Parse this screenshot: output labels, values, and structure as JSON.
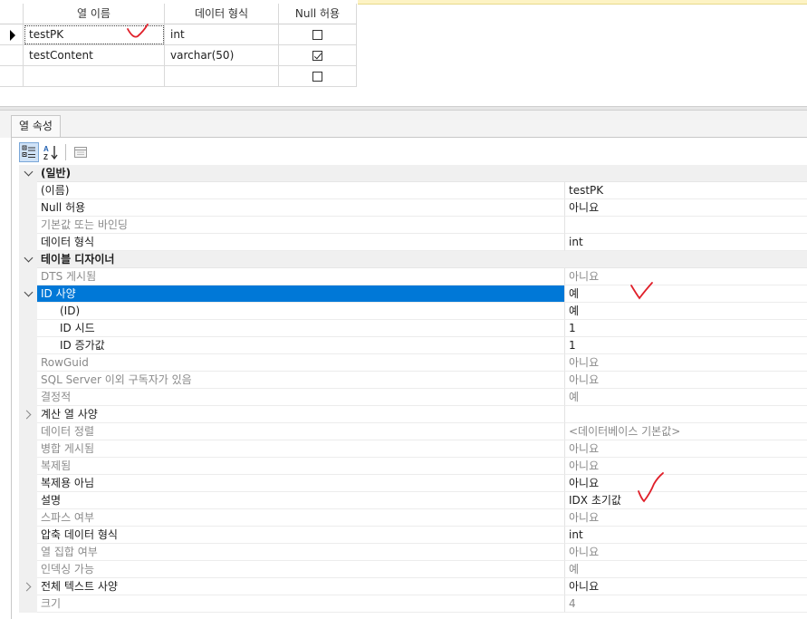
{
  "column_grid": {
    "headers": {
      "name": "열 이름",
      "type": "데이터 형식",
      "nullable": "Null 허용"
    },
    "rows": [
      {
        "name": "testPK",
        "type": "int",
        "nullable": false,
        "current": true
      },
      {
        "name": "testContent",
        "type": "varchar(50)",
        "nullable": true,
        "current": false
      },
      {
        "name": "",
        "type": "",
        "nullable": false,
        "current": false
      }
    ]
  },
  "properties_panel": {
    "tab_label": "열 속성",
    "toolbar": {
      "categorized_icon": "categorized-list-icon",
      "alphabetical_icon": "sort-az-icon",
      "property_pages_icon": "property-pages-icon"
    },
    "rows": [
      {
        "kind": "category",
        "name": "(일반)",
        "value": "",
        "expander": "expanded"
      },
      {
        "kind": "prop",
        "indent": 0,
        "name": "(이름)",
        "value": "testPK",
        "readonly": false
      },
      {
        "kind": "prop",
        "indent": 0,
        "name": "Null 허용",
        "value": "아니요",
        "readonly": false
      },
      {
        "kind": "prop",
        "indent": 0,
        "name": "기본값 또는 바인딩",
        "value": "",
        "readonly": true
      },
      {
        "kind": "prop",
        "indent": 0,
        "name": "데이터 형식",
        "value": "int",
        "readonly": false
      },
      {
        "kind": "category",
        "name": "테이블 디자이너",
        "value": "",
        "expander": "expanded"
      },
      {
        "kind": "prop",
        "indent": 0,
        "name": "DTS 게시됨",
        "value": "아니요",
        "readonly": true
      },
      {
        "kind": "prop",
        "indent": 0,
        "name": "ID 사양",
        "value": "예",
        "readonly": false,
        "selected": true,
        "expander": "expanded"
      },
      {
        "kind": "prop",
        "indent": 1,
        "name": "(ID)",
        "value": "예",
        "readonly": false
      },
      {
        "kind": "prop",
        "indent": 1,
        "name": "ID 시드",
        "value": "1",
        "readonly": false
      },
      {
        "kind": "prop",
        "indent": 1,
        "name": "ID 증가값",
        "value": "1",
        "readonly": false
      },
      {
        "kind": "prop",
        "indent": 0,
        "name": "RowGuid",
        "value": "아니요",
        "readonly": true
      },
      {
        "kind": "prop",
        "indent": 0,
        "name": "SQL Server 이외 구독자가 있음",
        "value": "아니요",
        "readonly": true
      },
      {
        "kind": "prop",
        "indent": 0,
        "name": "결정적",
        "value": "예",
        "readonly": true
      },
      {
        "kind": "prop",
        "indent": 0,
        "name": "계산 열 사양",
        "value": "",
        "readonly": false,
        "expander": "collapsed"
      },
      {
        "kind": "prop",
        "indent": 0,
        "name": "데이터 정렬",
        "value": "<데이터베이스 기본값>",
        "readonly": true
      },
      {
        "kind": "prop",
        "indent": 0,
        "name": "병합 게시됨",
        "value": "아니요",
        "readonly": true
      },
      {
        "kind": "prop",
        "indent": 0,
        "name": "복제됨",
        "value": "아니요",
        "readonly": true
      },
      {
        "kind": "prop",
        "indent": 0,
        "name": "복제용 아님",
        "value": "아니요",
        "readonly": false
      },
      {
        "kind": "prop",
        "indent": 0,
        "name": "설명",
        "value": "IDX 초기값",
        "readonly": false
      },
      {
        "kind": "prop",
        "indent": 0,
        "name": "스파스 여부",
        "value": "아니요",
        "readonly": true
      },
      {
        "kind": "prop",
        "indent": 0,
        "name": "압축 데이터 형식",
        "value": "int",
        "readonly": false
      },
      {
        "kind": "prop",
        "indent": 0,
        "name": "열 집합 여부",
        "value": "아니요",
        "readonly": true
      },
      {
        "kind": "prop",
        "indent": 0,
        "name": "인덱싱 가능",
        "value": "예",
        "readonly": true
      },
      {
        "kind": "prop",
        "indent": 0,
        "name": "전체 텍스트 사양",
        "value": "아니요",
        "readonly": false,
        "expander": "collapsed"
      },
      {
        "kind": "prop",
        "indent": 0,
        "name": "크기",
        "value": "4",
        "readonly": true
      }
    ]
  },
  "colors": {
    "selection": "#0078d7",
    "annotation_red": "#e0202a",
    "readonly_text": "#8a8a8a"
  }
}
